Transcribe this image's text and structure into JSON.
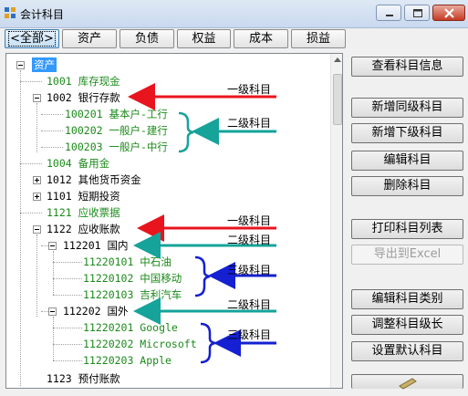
{
  "window": {
    "title": "会计科目"
  },
  "tabs": [
    "<全部>",
    "资产",
    "负债",
    "权益",
    "成本",
    "损益"
  ],
  "tree": {
    "root": "资产",
    "items": [
      "1001 库存现金",
      "1002 银行存款",
      "100201 基本户-工行",
      "100202 一般户-建行",
      "100203 一般户-中行",
      "1004 备用金",
      "1012 其他货币资金",
      "1101 短期投资",
      "1121 应收票据",
      "1122 应收账款",
      "112201 国内",
      "11220101 中石油",
      "11220102 中国移动",
      "11220103 吉利汽车",
      "112202 国外",
      "11220201 Google",
      "11220202 Microsoft",
      "11220203 Apple",
      "1123 预付账款"
    ]
  },
  "annotations": {
    "level1_a": "一级科目",
    "level2_a": "二级科目",
    "level1_b": "一级科目",
    "level2_b": "二级科目",
    "level3_a": "三级科目",
    "level2_c": "二级科目",
    "level3_b": "三级科目",
    "colors": {
      "red": "#e8141e",
      "teal": "#15a39a",
      "blue": "#1420d2",
      "green_text": "#1b8a1b"
    }
  },
  "buttons": {
    "view": "查看科目信息",
    "add_same": "新增同级科目",
    "add_child": "新增下级科目",
    "edit": "编辑科目",
    "delete": "删除科目",
    "print": "打印科目列表",
    "export": "导出到Excel",
    "edit_category": "编辑科目类别",
    "adjust_len": "调整科目级长",
    "set_default": "设置默认科目"
  }
}
